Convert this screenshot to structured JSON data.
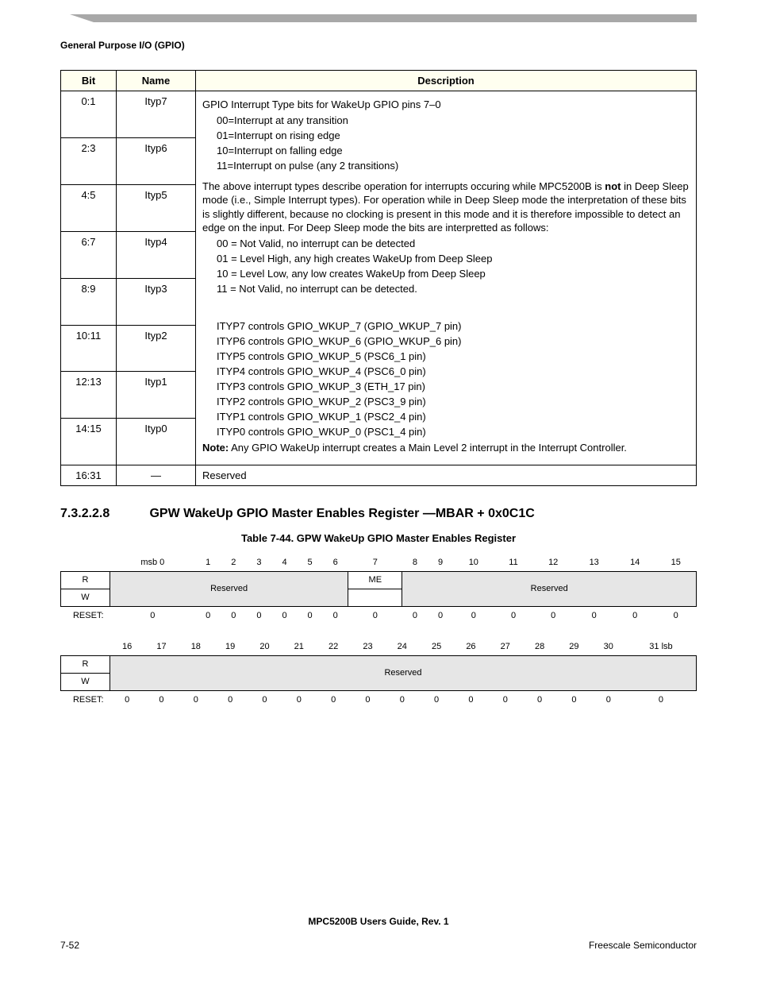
{
  "header": {
    "section_label": "General Purpose I/O (GPIO)"
  },
  "bit_table": {
    "headers": {
      "bit": "Bit",
      "name": "Name",
      "desc": "Description"
    },
    "rows": [
      {
        "bit": "0:1",
        "name": "Ityp7"
      },
      {
        "bit": "2:3",
        "name": "Ityp6"
      },
      {
        "bit": "4:5",
        "name": "Ityp5"
      },
      {
        "bit": "6:7",
        "name": "Ityp4"
      },
      {
        "bit": "8:9",
        "name": "Ityp3"
      },
      {
        "bit": "10:11",
        "name": "Ityp2"
      },
      {
        "bit": "12:13",
        "name": "Ityp1"
      },
      {
        "bit": "14:15",
        "name": "Ityp0"
      }
    ],
    "reserved": {
      "bit": "16:31",
      "name": "—",
      "desc": "Reserved"
    },
    "desc": {
      "intro": "GPIO Interrupt Type bits for WakeUp GPIO pins 7–0",
      "codes": [
        "00=Interrupt at any transition",
        "01=Interrupt on rising edge",
        "10=Interrupt on falling edge",
        "11=Interrupt on pulse (any 2 transitions)"
      ],
      "para1a": "The above interrupt types describe operation for interrupts occuring while MPC5200B is ",
      "para1b_bold": "not",
      "para1c": " in Deep Sleep mode (i.e., Simple Interrupt types). For operation while in Deep Sleep mode the interpretation of these bits is slightly different, because no clocking is present in this mode and it is therefore impossible to detect an edge on the input. For Deep Sleep mode the bits are interpretted as follows:",
      "deep_codes": [
        "00 = Not Valid, no interrupt can be detected",
        "01 = Level High, any high creates WakeUp from Deep Sleep",
        "10 = Level Low, any low creates WakeUp from Deep Sleep",
        "11 = Not Valid, no interrupt can be detected."
      ],
      "controls": [
        "ITYP7 controls GPIO_WKUP_7 (GPIO_WKUP_7 pin)",
        "ITYP6 controls GPIO_WKUP_6 (GPIO_WKUP_6 pin)",
        "ITYP5 controls GPIO_WKUP_5 (PSC6_1 pin)",
        "ITYP4 controls GPIO_WKUP_4 (PSC6_0 pin)",
        "ITYP3 controls GPIO_WKUP_3 (ETH_17 pin)",
        "ITYP2 controls GPIO_WKUP_2 (PSC3_9 pin)",
        "ITYP1 controls GPIO_WKUP_1 (PSC2_4 pin)",
        "ITYP0 controls GPIO_WKUP_0 (PSC1_4 pin)"
      ],
      "note_label": "Note:",
      "note_text": "  Any GPIO WakeUp interrupt creates a Main Level 2 interrupt in the Interrupt Controller."
    }
  },
  "section": {
    "num": "7.3.2.2.8",
    "title": "GPW WakeUp GPIO Master Enables Register —MBAR + 0x0C1C",
    "table_caption": "Table 7-44. GPW WakeUp GPIO Master Enables Register"
  },
  "reg": {
    "bits_hi": [
      "msb 0",
      "1",
      "2",
      "3",
      "4",
      "5",
      "6",
      "7",
      "8",
      "9",
      "10",
      "11",
      "12",
      "13",
      "14",
      "15"
    ],
    "bits_lo": [
      "16",
      "17",
      "18",
      "19",
      "20",
      "21",
      "22",
      "23",
      "24",
      "25",
      "26",
      "27",
      "28",
      "29",
      "30",
      "31 lsb"
    ],
    "r": "R",
    "w": "W",
    "reset": "RESET:",
    "reserved": "Reserved",
    "me": "ME",
    "reset_vals": [
      "0",
      "0",
      "0",
      "0",
      "0",
      "0",
      "0",
      "0",
      "0",
      "0",
      "0",
      "0",
      "0",
      "0",
      "0",
      "0"
    ]
  },
  "footer": {
    "doc": "MPC5200B Users Guide, Rev. 1",
    "page": "7-52",
    "company": "Freescale Semiconductor"
  }
}
